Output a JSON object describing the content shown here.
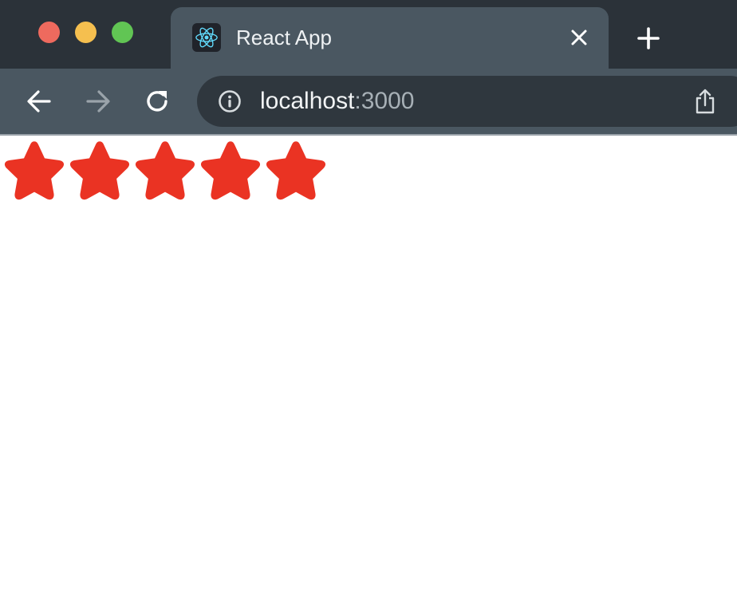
{
  "window": {
    "traffic_colors": {
      "close": "#ee6a5e",
      "minimize": "#f5bf4f",
      "maximize": "#61c554"
    }
  },
  "tab": {
    "title": "React App",
    "favicon": "react-logo-icon",
    "close_icon": "close-icon"
  },
  "new_tab_icon": "plus-icon",
  "toolbar": {
    "back_icon": "arrow-left-icon",
    "forward_icon": "arrow-right-icon",
    "reload_icon": "reload-icon",
    "url_host": "localhost",
    "url_port": ":3000",
    "info_icon": "info-icon",
    "share_icon": "share-icon"
  },
  "page": {
    "rating": {
      "filled": 5,
      "max": 5,
      "color": "#ea3323"
    }
  }
}
